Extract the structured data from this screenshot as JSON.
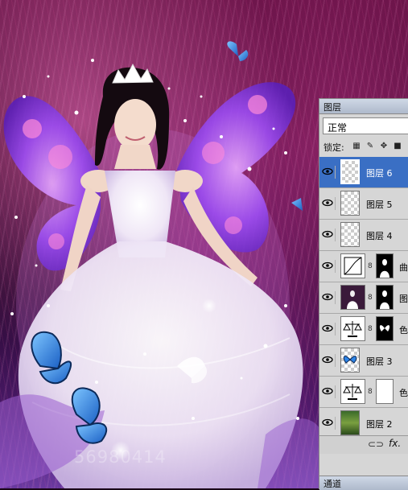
{
  "artwork": {
    "description_icon": "fairy-photo",
    "watermark": "56980414"
  },
  "layers_panel": {
    "tab_label": "图层",
    "blend_mode": "正常",
    "lock_label": "锁定:",
    "lock_icons": [
      "lock-transparent-icon",
      "lock-paint-icon",
      "lock-move-icon",
      "lock-all-icon"
    ],
    "layers": [
      {
        "name": "图层 6",
        "kind": "pixel",
        "selected": true
      },
      {
        "name": "图层 5",
        "kind": "pixel"
      },
      {
        "name": "图层 4",
        "kind": "pixel"
      },
      {
        "name": "曲",
        "kind": "curves-adjustment"
      },
      {
        "name": "图层",
        "kind": "photo-masked"
      },
      {
        "name": "色",
        "kind": "balance-adjustment"
      },
      {
        "name": "图层 3",
        "kind": "butterfly"
      },
      {
        "name": "色",
        "kind": "balance-adjustment-white-mask"
      },
      {
        "name": "图层 2",
        "kind": "photo"
      }
    ],
    "footer": {
      "link_icon": "link-icon",
      "fx_label": "fx."
    },
    "channels_tab": "通道"
  },
  "colors": {
    "selection": "#3a6fc4",
    "panel_bg": "#d6d6d6",
    "wing_purple": "#8a3cf0",
    "butterfly_blue": "#2f86e8"
  }
}
